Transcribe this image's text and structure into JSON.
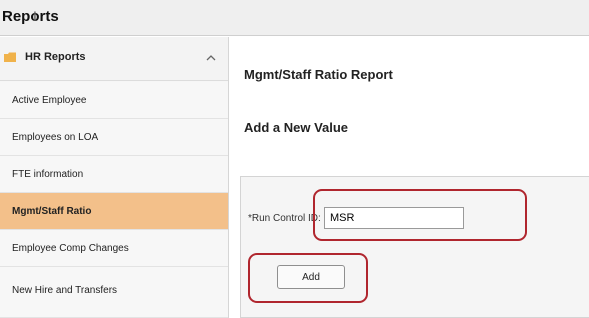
{
  "app": {
    "title": "Reports"
  },
  "sidebar": {
    "group": {
      "label": "HR Reports",
      "expanded": true
    },
    "items": [
      {
        "label": "Active Employee",
        "active": false
      },
      {
        "label": "Employees on LOA",
        "active": false
      },
      {
        "label": "FTE information",
        "active": false
      },
      {
        "label": "Mgmt/Staff Ratio",
        "active": true
      },
      {
        "label": "Employee Comp Changes",
        "active": false
      },
      {
        "label": "New Hire and Transfers",
        "active": false
      }
    ]
  },
  "main": {
    "page_title": "Mgmt/Staff Ratio Report",
    "section_title": "Add a New Value",
    "run_control": {
      "label": "*Run Control ID:",
      "value": "MSR"
    },
    "add_label": "Add"
  },
  "colors": {
    "accent_active": "#f3c08a",
    "annotation": "#b0262e",
    "folder": "#f0b24a"
  }
}
